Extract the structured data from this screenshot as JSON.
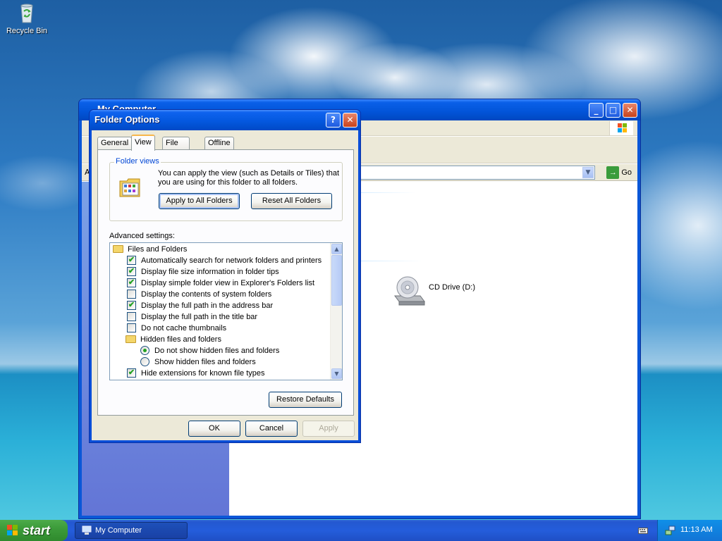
{
  "desktop": {
    "recycle_bin_label": "Recycle Bin"
  },
  "mycomputer": {
    "title": "My Computer",
    "go_label": "Go",
    "address_prefix": "A",
    "section_fragment": "ge",
    "cd_drive_label": "CD Drive (D:)"
  },
  "dialog": {
    "title": "Folder Options",
    "help_icon": "?",
    "close_icon": "✕",
    "tabs": [
      {
        "label": "General",
        "active": false
      },
      {
        "label": "View",
        "active": true
      },
      {
        "label": "File Types",
        "active": false
      },
      {
        "label": "Offline Files",
        "active": false
      }
    ],
    "folder_views": {
      "legend": "Folder views",
      "description": "You can apply the view (such as Details or Tiles) that you are using for this folder to all folders.",
      "apply_button": "Apply to All Folders",
      "reset_button": "Reset All Folders"
    },
    "advanced_label": "Advanced settings:",
    "advanced_items": [
      {
        "type": "folder",
        "label": "Files and Folders",
        "indent": 0
      },
      {
        "type": "checkbox",
        "checked": true,
        "label": "Automatically search for network folders and printers",
        "indent": 1
      },
      {
        "type": "checkbox",
        "checked": true,
        "label": "Display file size information in folder tips",
        "indent": 1
      },
      {
        "type": "checkbox",
        "checked": true,
        "label": "Display simple folder view in Explorer's Folders list",
        "indent": 1
      },
      {
        "type": "checkbox",
        "checked": false,
        "label": "Display the contents of system folders",
        "indent": 1
      },
      {
        "type": "checkbox",
        "checked": true,
        "label": "Display the full path in the address bar",
        "indent": 1
      },
      {
        "type": "checkbox",
        "checked": false,
        "label": "Display the full path in the title bar",
        "indent": 1
      },
      {
        "type": "checkbox",
        "checked": false,
        "label": "Do not cache thumbnails",
        "indent": 1
      },
      {
        "type": "folder",
        "label": "Hidden files and folders",
        "indent": 1
      },
      {
        "type": "radio",
        "checked": true,
        "label": "Do not show hidden files and folders",
        "indent": 2
      },
      {
        "type": "radio",
        "checked": false,
        "label": "Show hidden files and folders",
        "indent": 2
      },
      {
        "type": "checkbox",
        "checked": true,
        "label": "Hide extensions for known file types",
        "indent": 1
      }
    ],
    "restore_defaults": "Restore Defaults",
    "ok": "OK",
    "cancel": "Cancel",
    "apply": "Apply"
  },
  "taskbar": {
    "start_label": "start",
    "task_label": "My Computer",
    "clock": "11:13 AM"
  },
  "colors": {
    "xp_blue": "#0a4ed8",
    "dialog_face": "#ece9d8",
    "check_green": "#21a121",
    "start_green": "#3c9b3a"
  }
}
